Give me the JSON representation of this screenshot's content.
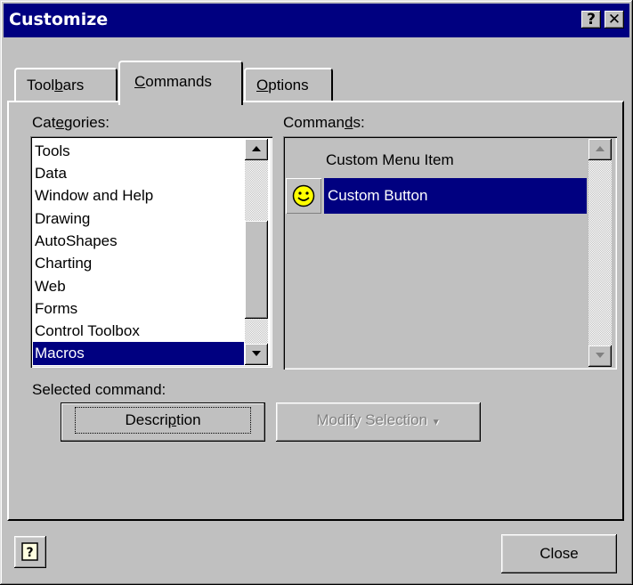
{
  "window": {
    "title": "Customize"
  },
  "titlebar": {
    "help_label": "?",
    "close_label": "✕"
  },
  "tabs": [
    {
      "label": "Toolbars",
      "pre": "Tool",
      "acc": "b",
      "post": "ars"
    },
    {
      "label": "Commands",
      "pre": "",
      "acc": "C",
      "post": "ommands"
    },
    {
      "label": "Options",
      "pre": "",
      "acc": "O",
      "post": "ptions"
    }
  ],
  "active_tab": "Commands",
  "categories": {
    "label_pre": "Cat",
    "label_acc": "e",
    "label_post": "gories:",
    "items": [
      "Tools",
      "Data",
      "Window and Help",
      "Drawing",
      "AutoShapes",
      "Charting",
      "Web",
      "Forms",
      "Control Toolbox",
      "Macros"
    ],
    "selected": "Macros"
  },
  "commands": {
    "label_pre": "Comman",
    "label_acc": "d",
    "label_post": "s:",
    "items": [
      {
        "label": "Custom Menu Item",
        "icon": ""
      },
      {
        "label": "Custom Button",
        "icon": "smiley-icon"
      }
    ],
    "selected": "Custom Button"
  },
  "selected_command": {
    "label": "Selected command:",
    "description_pre": "Descri",
    "description_acc": "p",
    "description_post": "tion",
    "modify_label": "Modify Selection",
    "modify_arrow": "▼"
  },
  "footer": {
    "close_label": "Close",
    "help_icon": "help-question-icon"
  }
}
